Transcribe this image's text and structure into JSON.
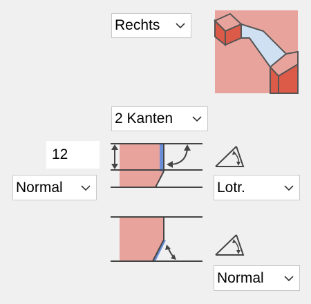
{
  "direction_select": {
    "value": "Rechts"
  },
  "edges_select": {
    "value": "2 Kanten"
  },
  "size_input": {
    "value": "12"
  },
  "upper_mode_select": {
    "value": "Normal"
  },
  "angle_ref_select": {
    "value": "Lotr."
  },
  "lower_mode_select": {
    "value": "Normal"
  },
  "icons": {
    "preview": "bevel-joint-preview-icon",
    "upper": "upper-bevel-profile-icon",
    "lower": "lower-bevel-profile-icon",
    "angle": "angle-icon",
    "chevron": "chevron-down-icon"
  },
  "colors": {
    "red_light": "#e8a49c",
    "red_dark": "#db5a48",
    "blue_light": "#cfe0f3",
    "edge_blue": "#6a8fd8"
  }
}
